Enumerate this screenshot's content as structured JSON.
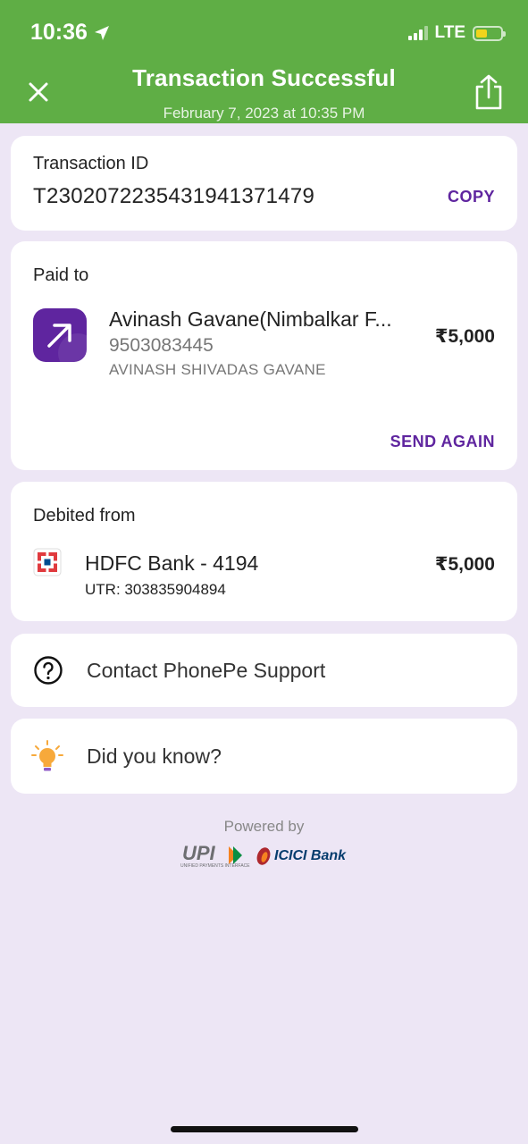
{
  "status_bar": {
    "time": "10:36",
    "network": "LTE"
  },
  "header": {
    "title": "Transaction Successful",
    "subtitle": "February 7, 2023 at 10:35 PM"
  },
  "transaction": {
    "label": "Transaction ID",
    "id": "T2302072235431941371479",
    "copy_label": "COPY"
  },
  "paid_to": {
    "label": "Paid to",
    "name": "Avinash Gavane(Nimbalkar F...",
    "phone": "9503083445",
    "legal_name": "AVINASH SHIVADAS GAVANE",
    "amount": "₹5,000",
    "send_again_label": "SEND AGAIN"
  },
  "debited_from": {
    "label": "Debited from",
    "bank": "HDFC Bank - 4194",
    "utr": "UTR: 303835904894",
    "amount": "₹5,000"
  },
  "support": {
    "label": "Contact PhonePe Support"
  },
  "did_you_know": {
    "label": "Did you know?"
  },
  "footer": {
    "powered_by": "Powered by",
    "upi_logo_text": "UPI",
    "upi_tagline": "UNIFIED PAYMENTS INTERFACE",
    "bank_logo_text": "ICICI Bank"
  },
  "icons": {
    "location": "location-arrow-icon",
    "close": "close-icon",
    "share": "share-icon",
    "payee": "arrow-up-right-icon",
    "bank": "hdfc-logo-icon",
    "help": "question-circle-icon",
    "tip": "lightbulb-icon"
  },
  "colors": {
    "header_green": "#5fae45",
    "brand_purple": "#5f259f",
    "background": "#ede6f5",
    "hdfc_red": "#e03a3e",
    "hdfc_blue": "#004c8f",
    "bulb_orange": "#f7a93b"
  }
}
